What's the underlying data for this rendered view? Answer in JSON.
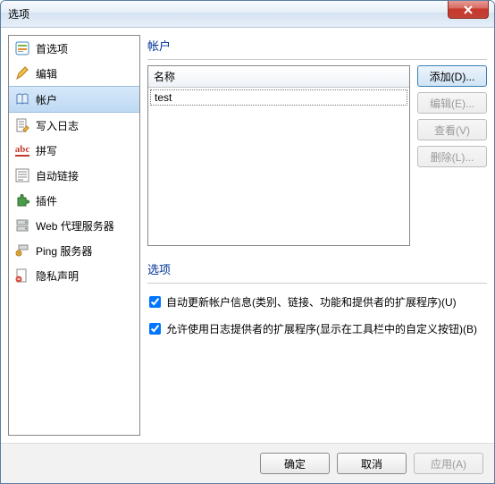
{
  "window": {
    "title": "选项"
  },
  "sidebar": {
    "items": [
      {
        "label": "首选项"
      },
      {
        "label": "编辑"
      },
      {
        "label": "帐户"
      },
      {
        "label": "写入日志"
      },
      {
        "label": "拼写"
      },
      {
        "label": "自动链接"
      },
      {
        "label": "插件"
      },
      {
        "label": "Web 代理服务器"
      },
      {
        "label": "Ping 服务器"
      },
      {
        "label": "隐私声明"
      }
    ]
  },
  "panel": {
    "title": "帐户",
    "table_header": "名称",
    "rows": [
      "test"
    ],
    "buttons": {
      "add": "添加(D)...",
      "edit": "编辑(E)...",
      "view": "查看(V)",
      "delete": "删除(L)..."
    },
    "options_title": "选项",
    "checkbox1": "自动更新帐户信息(类别、链接、功能和提供者的扩展程序)(U)",
    "checkbox2": "允许使用日志提供者的扩展程序(显示在工具栏中的自定义按钮)(B)"
  },
  "footer": {
    "ok": "确定",
    "cancel": "取消",
    "apply": "应用(A)"
  }
}
